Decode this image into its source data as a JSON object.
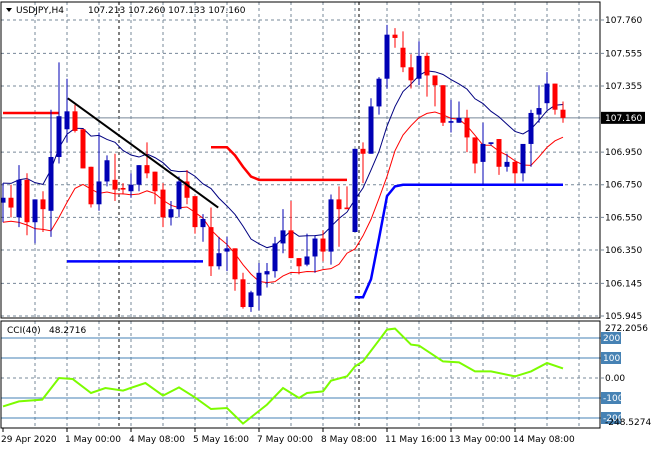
{
  "header": {
    "arrow_icon": "triangle-down-icon",
    "symbol": "USDJPY,H4",
    "ohlc": "107.213 107.260 107.133 107.160"
  },
  "colors": {
    "bull": "#0000b4",
    "bear": "#ff0000",
    "ma_upper": "#000080",
    "ma_lower": "#ff0000",
    "step_red": "#ff0000",
    "step_blue": "#0000ff",
    "trend": "#000000",
    "cci": "#7cfc00",
    "level_box": "#4682b4"
  },
  "chart_data": [
    {
      "type": "candlestick",
      "title": "USDJPY,H4",
      "current_price": "107.160",
      "ylim": [
        105.945,
        107.76
      ],
      "price_ticks": [
        "107.760",
        "107.555",
        "107.355",
        "106.950",
        "106.750",
        "106.550",
        "106.350",
        "106.145",
        "105.945"
      ],
      "price_tick_values": [
        107.76,
        107.555,
        107.355,
        106.95,
        106.75,
        106.55,
        106.35,
        106.145,
        105.945
      ],
      "time_labels": [
        "29 Apr 2020",
        "1 May 00:00",
        "4 May 08:00",
        "5 May 16:00",
        "7 May 00:00",
        "8 May 08:00",
        "11 May 16:00",
        "13 May 00:00",
        "14 May 08:00"
      ],
      "time_label_candle_index": [
        0,
        8,
        16,
        24,
        32,
        40,
        48,
        56,
        64
      ],
      "period_separators_candle_index": [
        14,
        44
      ],
      "candles": [
        [
          106.64,
          106.76,
          106.52,
          106.67
        ],
        [
          106.67,
          106.75,
          106.55,
          106.61
        ],
        [
          106.55,
          106.87,
          106.49,
          106.78
        ],
        [
          106.78,
          106.82,
          106.44,
          106.52
        ],
        [
          106.52,
          106.66,
          106.39,
          106.66
        ],
        [
          106.66,
          106.71,
          106.46,
          106.6
        ],
        [
          106.59,
          107.21,
          106.43,
          106.92
        ],
        [
          106.92,
          107.5,
          106.88,
          107.17
        ],
        [
          107.09,
          107.4,
          107.01,
          107.2
        ],
        [
          107.2,
          107.24,
          107.07,
          107.08
        ],
        [
          107.09,
          107.09,
          106.85,
          106.85
        ],
        [
          106.86,
          106.86,
          106.61,
          106.63
        ],
        [
          106.63,
          107.07,
          106.59,
          106.77
        ],
        [
          106.77,
          106.93,
          106.74,
          106.9
        ],
        [
          106.78,
          106.94,
          106.65,
          106.72
        ],
        [
          106.73,
          106.76,
          106.69,
          106.72
        ],
        [
          106.71,
          106.82,
          106.67,
          106.75
        ],
        [
          106.75,
          106.87,
          106.71,
          106.87
        ],
        [
          106.87,
          107.01,
          106.79,
          106.82
        ],
        [
          106.83,
          106.83,
          106.63,
          106.71
        ],
        [
          106.72,
          106.76,
          106.49,
          106.55
        ],
        [
          106.55,
          106.65,
          106.5,
          106.6
        ],
        [
          106.6,
          106.8,
          106.55,
          106.77
        ],
        [
          106.77,
          106.84,
          106.63,
          106.67
        ],
        [
          106.68,
          106.68,
          106.45,
          106.49
        ],
        [
          106.49,
          106.57,
          106.4,
          106.54
        ],
        [
          106.49,
          106.61,
          106.19,
          106.25
        ],
        [
          106.25,
          106.43,
          106.23,
          106.33
        ],
        [
          106.34,
          106.43,
          106.22,
          106.36
        ],
        [
          106.36,
          106.36,
          106.1,
          106.17
        ],
        [
          106.17,
          106.21,
          105.99,
          106.0
        ],
        [
          106.0,
          106.1,
          105.97,
          106.09
        ],
        [
          106.07,
          106.27,
          105.98,
          106.21
        ],
        [
          106.2,
          106.27,
          106.12,
          106.22
        ],
        [
          106.22,
          106.43,
          106.18,
          106.39
        ],
        [
          106.39,
          106.6,
          106.33,
          106.47
        ],
        [
          106.47,
          106.65,
          106.3,
          106.3
        ],
        [
          106.3,
          106.3,
          106.2,
          106.25
        ],
        [
          106.26,
          106.45,
          106.25,
          106.31
        ],
        [
          106.31,
          106.44,
          106.21,
          106.42
        ],
        [
          106.42,
          106.47,
          106.28,
          106.34
        ],
        [
          106.34,
          106.69,
          106.26,
          106.66
        ],
        [
          106.66,
          106.74,
          106.37,
          106.6
        ],
        [
          106.61,
          106.74,
          106.6,
          106.6
        ],
        [
          106.46,
          106.97,
          106.46,
          106.97
        ],
        [
          106.97,
          107.01,
          106.76,
          106.94
        ],
        [
          106.94,
          107.28,
          106.94,
          107.23
        ],
        [
          107.23,
          107.41,
          107.18,
          107.4
        ],
        [
          107.4,
          107.73,
          107.34,
          107.67
        ],
        [
          107.67,
          107.71,
          107.59,
          107.65
        ],
        [
          107.59,
          107.69,
          107.44,
          107.47
        ],
        [
          107.47,
          107.55,
          107.34,
          107.39
        ],
        [
          107.4,
          107.63,
          107.36,
          107.54
        ],
        [
          107.54,
          107.56,
          107.29,
          107.42
        ],
        [
          107.42,
          107.42,
          107.23,
          107.36
        ],
        [
          107.36,
          107.36,
          107.11,
          107.13
        ],
        [
          107.13,
          107.27,
          107.07,
          107.14
        ],
        [
          107.13,
          107.26,
          107.13,
          107.16
        ],
        [
          107.16,
          107.21,
          106.95,
          107.04
        ],
        [
          107.04,
          107.04,
          106.82,
          106.88
        ],
        [
          106.89,
          107.13,
          106.75,
          107.0
        ],
        [
          107.0,
          107.01,
          106.99,
          107.01
        ],
        [
          107.03,
          107.03,
          106.81,
          106.86
        ],
        [
          106.86,
          106.94,
          106.83,
          106.89
        ],
        [
          106.89,
          106.9,
          106.76,
          106.82
        ],
        [
          106.82,
          107.0,
          106.77,
          107.0
        ],
        [
          107.0,
          107.21,
          106.86,
          107.19
        ],
        [
          107.18,
          107.36,
          107.13,
          107.22
        ],
        [
          107.25,
          107.44,
          107.21,
          107.37
        ],
        [
          107.37,
          107.37,
          107.18,
          107.21
        ],
        [
          107.21,
          107.26,
          107.13,
          107.16
        ]
      ],
      "step_red_segments": [
        [
          [
            0,
            107.19
          ],
          [
            7,
            107.19
          ]
        ],
        [
          [
            26,
            106.98
          ],
          [
            28,
            106.98
          ],
          [
            29,
            106.93
          ],
          [
            30,
            106.86
          ],
          [
            31,
            106.8
          ],
          [
            32,
            106.78
          ],
          [
            43,
            106.78
          ]
        ]
      ],
      "step_blue_segments": [
        [
          [
            8,
            106.28
          ],
          [
            25,
            106.28
          ]
        ],
        [
          [
            44,
            106.06
          ],
          [
            45,
            106.06
          ],
          [
            46,
            106.17
          ],
          [
            47,
            106.42
          ],
          [
            48,
            106.68
          ],
          [
            49,
            106.74
          ],
          [
            50,
            106.75
          ],
          [
            70,
            106.75
          ]
        ]
      ],
      "trendline": [
        [
          8.1,
          107.28
        ],
        [
          26.9,
          106.61
        ]
      ]
    },
    {
      "type": "line",
      "title": "CCI(40)",
      "last_value": "48.2716",
      "ylim": [
        -248.5274,
        272.2056
      ],
      "axis_max_label": "272.2056",
      "axis_min_label": "-248.5274",
      "zero_label": "0.00",
      "levels": [
        200,
        100,
        -100,
        -200
      ],
      "level_labels": [
        "200",
        "100",
        "-100",
        "-200"
      ],
      "points": [
        [
          0,
          -142
        ],
        [
          2,
          -117
        ],
        [
          4.9,
          -108
        ],
        [
          7,
          0
        ],
        [
          8.7,
          -5
        ],
        [
          11,
          -75
        ],
        [
          12.8,
          -50
        ],
        [
          15,
          -63
        ],
        [
          17.8,
          -25
        ],
        [
          20,
          -88
        ],
        [
          22,
          -47
        ],
        [
          24,
          -97
        ],
        [
          26,
          -155
        ],
        [
          28,
          -150
        ],
        [
          30,
          -228
        ],
        [
          33,
          -133
        ],
        [
          35,
          -50
        ],
        [
          37,
          -100
        ],
        [
          38,
          -75
        ],
        [
          40,
          -67
        ],
        [
          41,
          -13
        ],
        [
          43,
          8
        ],
        [
          44,
          58
        ],
        [
          45,
          83
        ],
        [
          48,
          242
        ],
        [
          49,
          247
        ],
        [
          51,
          167
        ],
        [
          52,
          162
        ],
        [
          55,
          83
        ],
        [
          57,
          78
        ],
        [
          59,
          33
        ],
        [
          61,
          33
        ],
        [
          64,
          8
        ],
        [
          66,
          33
        ],
        [
          68,
          75
        ],
        [
          70,
          48
        ]
      ]
    }
  ]
}
